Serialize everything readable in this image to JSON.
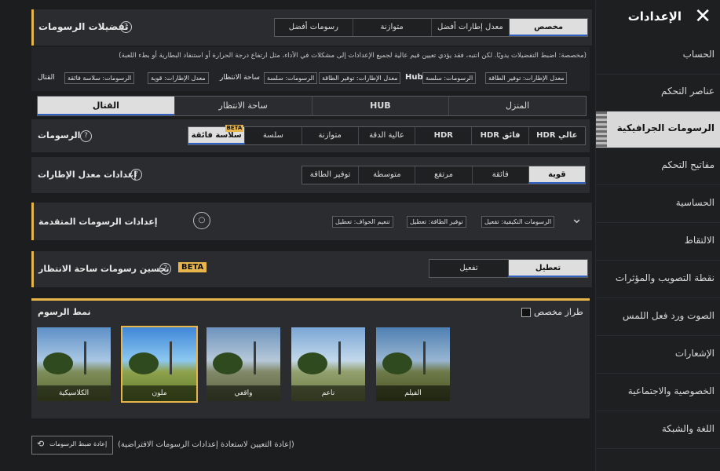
{
  "sidebar": {
    "title": "الإعدادات",
    "close": "✕",
    "items": [
      {
        "label": "الحساب"
      },
      {
        "label": "عناصر التحكم"
      },
      {
        "label": "الرسومات الجرافيكية"
      },
      {
        "label": "مفاتيح التحكم"
      },
      {
        "label": "الحساسية"
      },
      {
        "label": "الالتقاط"
      },
      {
        "label": "نقطة التصويب والمؤثرات"
      },
      {
        "label": "الصوت ورد فعل اللمس"
      },
      {
        "label": "الإشعارات"
      },
      {
        "label": "الخصوصية والاجتماعية"
      },
      {
        "label": "اللغة والشبكة"
      }
    ]
  },
  "prefs": {
    "title": "تفضيلات الرسومات",
    "qm": "?",
    "options": [
      "مخصص",
      "معدل إطارات أفضل",
      "متوازنة",
      "رسومات أفضل"
    ],
    "note": "(مخصصة: اضبط التفضيلات يدويًا. لكن انتبه، فقد يؤدي تعيين قيم عالية لجميع الإعدادات إلى مشكلات في الأداء، مثل ارتفاع درجة الحرارة أو استنفاد البطارية أو بطء اللعبة)",
    "summary": {
      "battle_label": "القتال",
      "battle_graphics": "الرسومات: سلاسة فائقة",
      "battle_fps": "معدل الإطارات: قوية",
      "lobby_label": "ساحة الانتظار",
      "lobby_graphics": "الرسومات: سلسة",
      "lobby_fps": "معدل الإطارات: توفير الطاقة",
      "hub_label": "Hub",
      "hub_graphics": "الرسومات: سلسة",
      "hub_fps": "معدل الإطارات: توفير الطاقة"
    }
  },
  "scene_tabs": [
    "القتال",
    "ساحة الانتظار",
    "HUB",
    "المنزل"
  ],
  "graphics": {
    "label": "الرسومات",
    "options": [
      "سلاسة فائقة",
      "سلسة",
      "متوازنة",
      "عالية الدقة",
      "HDR",
      "HDR فائق",
      "HDR عالي"
    ],
    "beta": "BETA"
  },
  "fps": {
    "label": "إعدادات معدل الإطارات",
    "options": [
      "قوية",
      "فائقة",
      "مرتفع",
      "متوسطة",
      "توفير الطاقة"
    ]
  },
  "advanced": {
    "title": "إعدادات الرسومات المتقدمة",
    "tags": [
      "الرسومات التكيفية: تفعيل",
      "توفير الطاقة: تعطيل",
      "تنعيم الحواف: تعطيل"
    ],
    "chevron": "⌄",
    "circle": "○"
  },
  "lobby_enh": {
    "title": "تحسين رسومات ساحة الانتظار",
    "beta": "BETA",
    "options": [
      "تعطيل",
      "تفعيل"
    ]
  },
  "style": {
    "title": "نمط الرسوم",
    "custom": "طراز مخصص",
    "thumbs": [
      "الكلاسيكية",
      "ملون",
      "واقعي",
      "ناعم",
      "الفيلم"
    ]
  },
  "footer": {
    "reset_btn": "إعادة ضبط الرسومات",
    "reset_note": "(إعادة التعيين لاستعادة إعدادات الرسومات الافتراضية)"
  },
  "colors": {
    "accent": "#e7b54a",
    "selected_bg": "#dedede",
    "underline": "#2f5fbf"
  }
}
